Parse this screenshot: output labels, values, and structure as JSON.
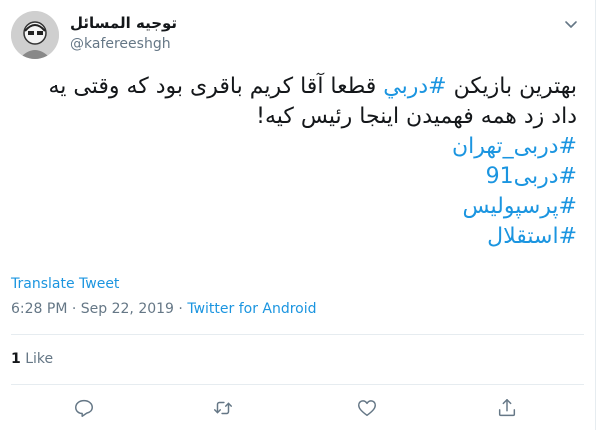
{
  "tweet": {
    "display_name": "توجیه المسائل",
    "handle": "@kafereeshgh",
    "text_before_tag": "بهترین بازیکن ",
    "tag_inline": "#دربي",
    "text_after_tag": " قطعا آقا کریم باقری بود که وقتی یه داد زد همه فهمیدن اینجا رئیس کیه!",
    "hashtags": [
      "#دربی_تهران",
      "#دربی91",
      "#پرسپولیس",
      "#استقلال"
    ],
    "translate_label": "Translate Tweet",
    "time": "6:28 PM",
    "date": "Sep 22, 2019",
    "separator": "·",
    "source": "Twitter for Android",
    "likes_count": "1",
    "likes_label": "Like"
  },
  "icons": {
    "menu": "chevron-down-icon",
    "reply": "reply-icon",
    "retweet": "retweet-icon",
    "like": "heart-icon",
    "share": "share-icon"
  },
  "colors": {
    "accent": "#1b95e0",
    "text": "#14171a",
    "secondary": "#657786",
    "divider": "#e6ecf0"
  }
}
